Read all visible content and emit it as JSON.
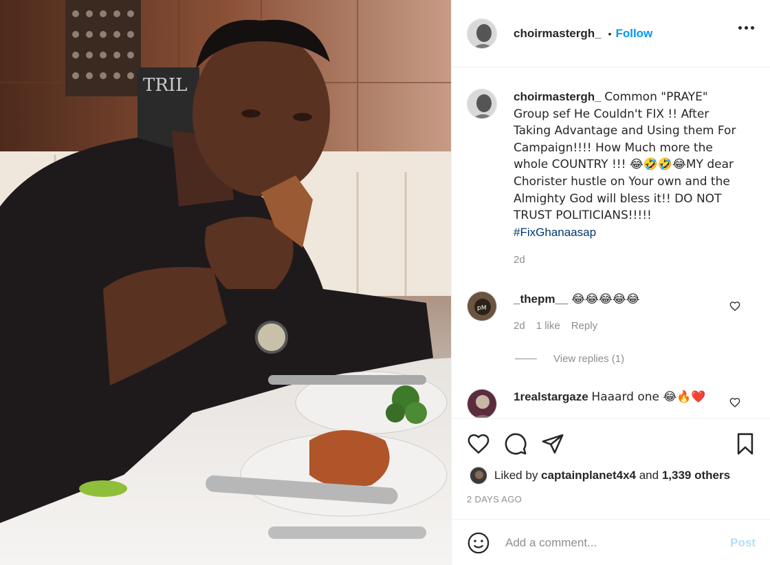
{
  "post": {
    "username": "choirmastergh_",
    "follow_label": "Follow",
    "dot": "•"
  },
  "caption": {
    "username": "choirmastergh_",
    "text": "Common \"PRAYE\" Group sef He Couldn't FIX !! After Taking Advantage and Using them For Campaign!!!! How Much more the whole COUNTRY !!! 😂🤣🤣😂MY dear Chorister hustle on Your own and the Almighty God will bless it!! DO NOT TRUST POLITICIANS!!!!!",
    "hashtag": "#FixGhanaasap",
    "age": "2d"
  },
  "comments": [
    {
      "username": "_thepm__",
      "text": "😂😂😂😂😂",
      "age": "2d",
      "likes": "1 like",
      "reply_label": "Reply"
    },
    {
      "username": "1realstargaze",
      "text": "Haaard one 😂🔥❤️"
    }
  ],
  "view_replies": "View replies (1)",
  "likes": {
    "prefix": "Liked by ",
    "user": "captainplanet4x4",
    "middle": " and ",
    "count": "1,339 others"
  },
  "posted_ago": "2 DAYS AGO",
  "add_comment": {
    "placeholder": "Add a comment...",
    "post_label": "Post"
  },
  "colors": {
    "link_blue": "#0095f6",
    "hashtag": "#00376b",
    "muted": "#8e8e8e",
    "post_disabled": "#b2dffc"
  },
  "icons": [
    "heart-icon",
    "comment-icon",
    "share-icon",
    "bookmark-icon",
    "more-icon",
    "emoji-icon"
  ]
}
